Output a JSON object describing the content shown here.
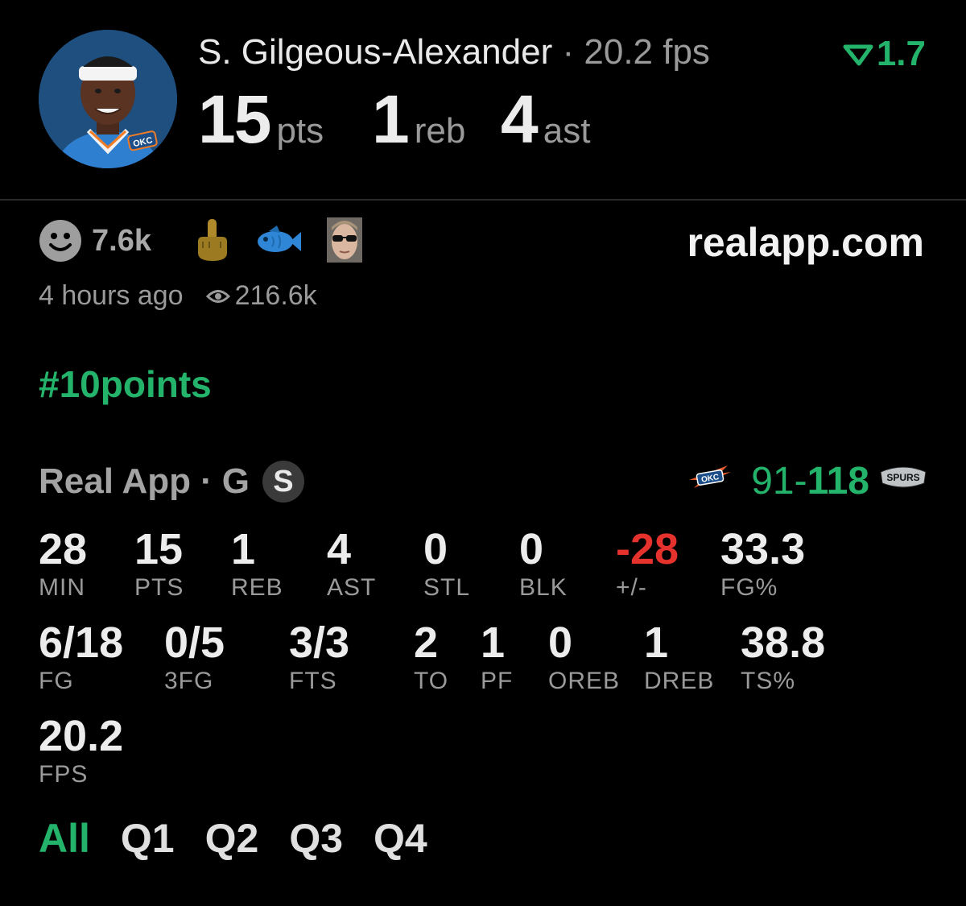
{
  "header": {
    "player_name": "S. Gilgeous-Alexander",
    "separator": "·",
    "fps_label": "20.2 fps",
    "trend_value": "1.7",
    "stats": [
      {
        "value": "15",
        "unit": "pts"
      },
      {
        "value": "1",
        "unit": "reb"
      },
      {
        "value": "4",
        "unit": "ast"
      }
    ]
  },
  "reactions": {
    "count": "7.6k",
    "icons": [
      "smiley-icon",
      "middle-finger-emoji",
      "fish-emoji",
      "sunglasses-face-emoji"
    ]
  },
  "site": "realapp.com",
  "meta": {
    "time_ago": "4 hours ago",
    "views": "216.6k"
  },
  "hashtag": "#10points",
  "game": {
    "source": "Real App",
    "position": "G",
    "badge": "S",
    "score_home": "91",
    "score_dash": "-",
    "score_away": "118",
    "home_team_logo": "okc-thunder-logo",
    "away_team_logo": "san-antonio-spurs-logo"
  },
  "stat_rows": [
    [
      {
        "value": "28",
        "label": "MIN"
      },
      {
        "value": "15",
        "label": "PTS"
      },
      {
        "value": "1",
        "label": "REB"
      },
      {
        "value": "4",
        "label": "AST"
      },
      {
        "value": "0",
        "label": "STL"
      },
      {
        "value": "0",
        "label": "BLK"
      },
      {
        "value": "-28",
        "label": "+/-"
      },
      {
        "value": "33.3",
        "label": "FG%"
      }
    ],
    [
      {
        "value": "6/18",
        "label": "FG"
      },
      {
        "value": "0/5",
        "label": "3FG"
      },
      {
        "value": "3/3",
        "label": "FTS"
      },
      {
        "value": "2",
        "label": "TO"
      },
      {
        "value": "1",
        "label": "PF"
      },
      {
        "value": "0",
        "label": "OREB"
      },
      {
        "value": "1",
        "label": "DREB"
      },
      {
        "value": "38.8",
        "label": "TS%"
      }
    ],
    [
      {
        "value": "20.2",
        "label": "FPS"
      }
    ]
  ],
  "tabs": [
    "All",
    "Q1",
    "Q2",
    "Q3",
    "Q4"
  ],
  "active_tab": "All",
  "colors": {
    "accent_green": "#24b36b",
    "negative_red": "#e5322d",
    "background": "#000000"
  }
}
